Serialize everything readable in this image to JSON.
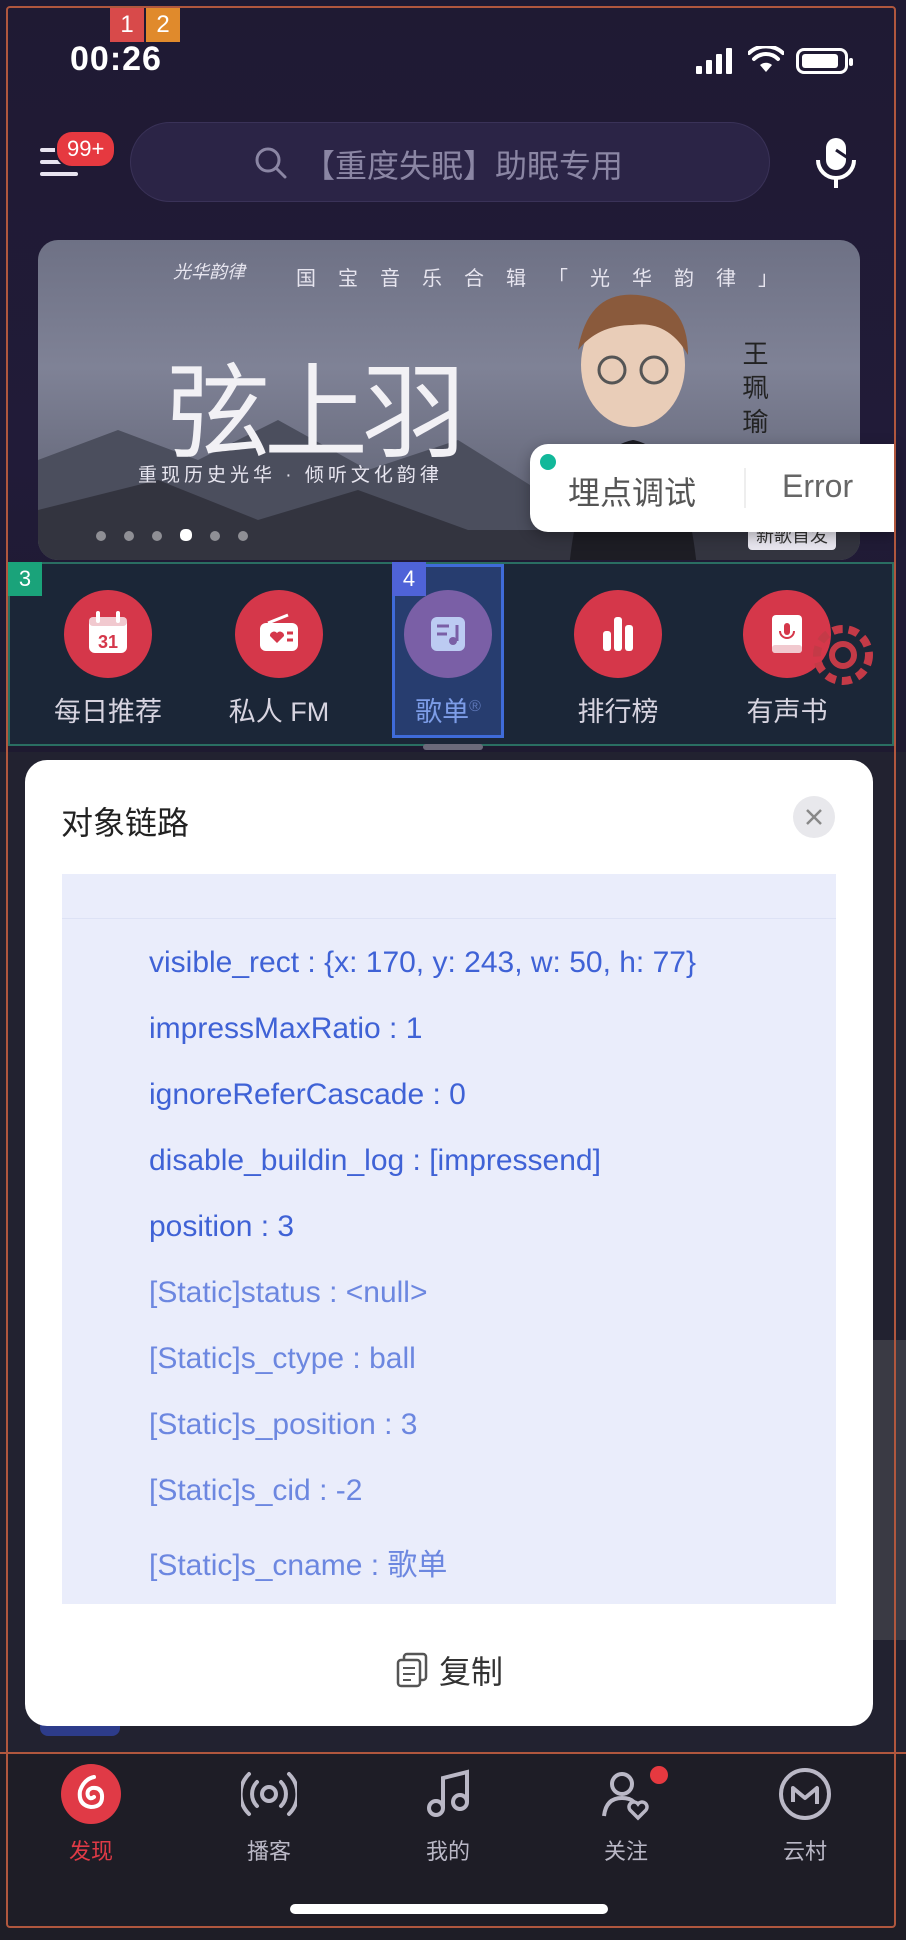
{
  "status_bar": {
    "time": "00:26"
  },
  "debug_tags": {
    "t1": "1",
    "t2": "2",
    "t3": "3",
    "t4": "4"
  },
  "header": {
    "menu_badge": "99+",
    "search_placeholder": "【重度失眠】助眠专用"
  },
  "banner": {
    "brand": "光华韵律",
    "headline": "国宝音乐合辑「光华韵律」",
    "title": "弦上羽",
    "subtitle": "重现历史光华 · 倾听文化韵律",
    "artist": "王珮瑜",
    "tag": "新歌首发",
    "dot_count": 6,
    "active_dot": 3
  },
  "debug_popup": {
    "label": "埋点调试",
    "status": "Error"
  },
  "nav": {
    "items": [
      {
        "label": "每日推荐",
        "icon": "calendar-icon",
        "day": "31"
      },
      {
        "label": "私人 FM",
        "icon": "radio-icon"
      },
      {
        "label": "歌单",
        "icon": "playlist-icon",
        "mark": "®"
      },
      {
        "label": "排行榜",
        "icon": "chart-icon"
      },
      {
        "label": "有声书",
        "icon": "audiobook-icon"
      }
    ]
  },
  "modal": {
    "title": "对象链路",
    "lines": [
      {
        "text": "visible_rect : {x: 170, y: 243, w: 50, h: 77}",
        "kind": "strong"
      },
      {
        "text": "impressMaxRatio : 1",
        "kind": "strong"
      },
      {
        "text": "ignoreReferCascade : 0",
        "kind": "strong"
      },
      {
        "text": "disable_buildin_log : [impressend]",
        "kind": "strong"
      },
      {
        "text": "position : 3",
        "kind": "strong"
      },
      {
        "text": "[Static]status : <null>",
        "kind": "static"
      },
      {
        "text": "[Static]s_ctype : ball",
        "kind": "static"
      },
      {
        "text": "[Static]s_position : 3",
        "kind": "static"
      },
      {
        "text": "[Static]s_cid : -2",
        "kind": "static"
      },
      {
        "text": "[Static]s_cname : 歌单",
        "kind": "static"
      }
    ],
    "copy_label": "复制"
  },
  "tabbar": {
    "tabs": [
      {
        "label": "发现",
        "icon": "discover-icon",
        "active": true
      },
      {
        "label": "播客",
        "icon": "podcast-icon"
      },
      {
        "label": "我的",
        "icon": "music-note-icon"
      },
      {
        "label": "关注",
        "icon": "follow-icon"
      },
      {
        "label": "云村",
        "icon": "cloud-village-icon"
      }
    ]
  },
  "colors": {
    "accent": "#d5374a",
    "debug_blue": "#3f62d6",
    "static_blue": "#6c87e0"
  }
}
